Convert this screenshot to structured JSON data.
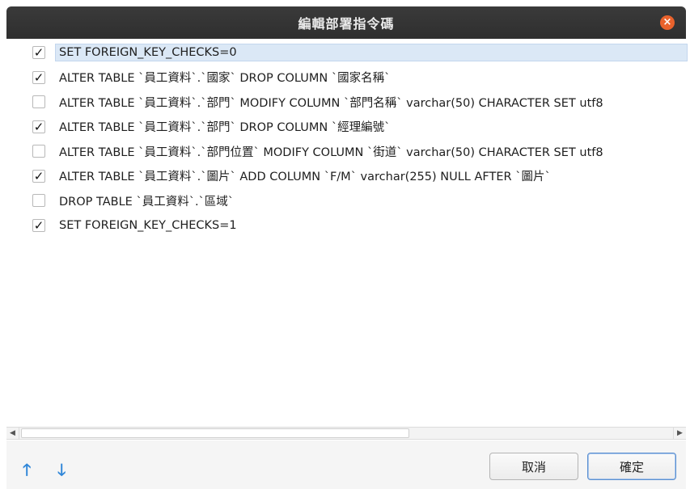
{
  "window": {
    "title": "編輯部署指令碼",
    "close_icon": "close-icon"
  },
  "statements": [
    {
      "checked": true,
      "text": "SET FOREIGN_KEY_CHECKS=0"
    },
    {
      "checked": true,
      "text": "ALTER TABLE `員工資料`.`國家` DROP COLUMN `國家名稱`"
    },
    {
      "checked": false,
      "text": "ALTER TABLE `員工資料`.`部門` MODIFY COLUMN `部門名稱` varchar(50) CHARACTER SET utf8"
    },
    {
      "checked": true,
      "text": "ALTER TABLE `員工資料`.`部門` DROP COLUMN `經理編號`"
    },
    {
      "checked": false,
      "text": "ALTER TABLE `員工資料`.`部門位置` MODIFY COLUMN `街道` varchar(50) CHARACTER SET utf8"
    },
    {
      "checked": true,
      "text": "ALTER TABLE `員工資料`.`圖片` ADD COLUMN `F/M` varchar(255) NULL AFTER `圖片`"
    },
    {
      "checked": false,
      "text": "DROP TABLE `員工資料`.`區域`"
    },
    {
      "checked": true,
      "text": "SET FOREIGN_KEY_CHECKS=1"
    }
  ],
  "selected_index": 0,
  "footer": {
    "move_up_icon": "arrow-up-icon",
    "move_down_icon": "arrow-down-icon",
    "cancel_label": "取消",
    "ok_label": "確定"
  },
  "colors": {
    "accent": "#2f86d8",
    "close": "#e9622c",
    "selection": "#dbe8f6"
  }
}
